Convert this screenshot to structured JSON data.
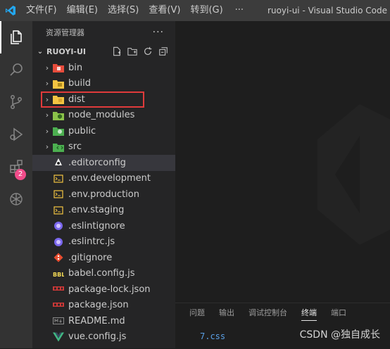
{
  "titlebar": {
    "menus": [
      "文件(F)",
      "编辑(E)",
      "选择(S)",
      "查看(V)",
      "转到(G)"
    ],
    "more": "···",
    "title": "ruoyi-ui - Visual Studio Code"
  },
  "activitybar": {
    "items": [
      "explorer-icon",
      "search-icon",
      "source-control-icon",
      "run-debug-icon",
      "extensions-icon",
      "openai-icon"
    ],
    "extensions_badge": "2"
  },
  "explorer": {
    "header": "资源管理器",
    "more": "···",
    "project": "RUOYI-UI",
    "items": [
      {
        "label": "bin",
        "type": "folder",
        "icon": "folder-bin-icon",
        "color": "#e74c3c"
      },
      {
        "label": "build",
        "type": "folder",
        "icon": "folder-build-icon",
        "color": "#f4c542"
      },
      {
        "label": "dist",
        "type": "folder",
        "icon": "folder-dist-icon",
        "color": "#f4c542",
        "highlighted": true
      },
      {
        "label": "node_modules",
        "type": "folder",
        "icon": "folder-node-icon",
        "color": "#8bc34a"
      },
      {
        "label": "public",
        "type": "folder",
        "icon": "folder-public-icon",
        "color": "#4caf50"
      },
      {
        "label": "src",
        "type": "folder",
        "icon": "folder-src-icon",
        "color": "#4caf50"
      },
      {
        "label": ".editorconfig",
        "type": "file",
        "icon": "editorconfig-icon",
        "color": "#ffffff",
        "selected": true
      },
      {
        "label": ".env.development",
        "type": "file",
        "icon": "env-file-icon",
        "color": "#f4c542"
      },
      {
        "label": ".env.production",
        "type": "file",
        "icon": "env-file-icon",
        "color": "#f4c542"
      },
      {
        "label": ".env.staging",
        "type": "file",
        "icon": "env-file-icon",
        "color": "#f4c542"
      },
      {
        "label": ".eslintignore",
        "type": "file",
        "icon": "eslint-icon",
        "color": "#7b68ee"
      },
      {
        "label": ".eslintrc.js",
        "type": "file",
        "icon": "eslint-icon",
        "color": "#7b68ee"
      },
      {
        "label": ".gitignore",
        "type": "file",
        "icon": "git-icon",
        "color": "#e84e31"
      },
      {
        "label": "babel.config.js",
        "type": "file",
        "icon": "babel-icon",
        "color": "#f5da55"
      },
      {
        "label": "package-lock.json",
        "type": "file",
        "icon": "npm-icon",
        "color": "#cb3837"
      },
      {
        "label": "package.json",
        "type": "file",
        "icon": "npm-icon",
        "color": "#cb3837"
      },
      {
        "label": "README.md",
        "type": "file",
        "icon": "markdown-icon",
        "color": "#519aba"
      },
      {
        "label": "vue.config.js",
        "type": "file",
        "icon": "vue-icon",
        "color": "#41b883"
      }
    ]
  },
  "panel": {
    "tabs": [
      "问题",
      "输出",
      "调试控制台",
      "终端",
      "端口"
    ],
    "active_tab": "终端",
    "terminal_line": "7.css",
    "watermark": "CSDN @独自成长"
  }
}
